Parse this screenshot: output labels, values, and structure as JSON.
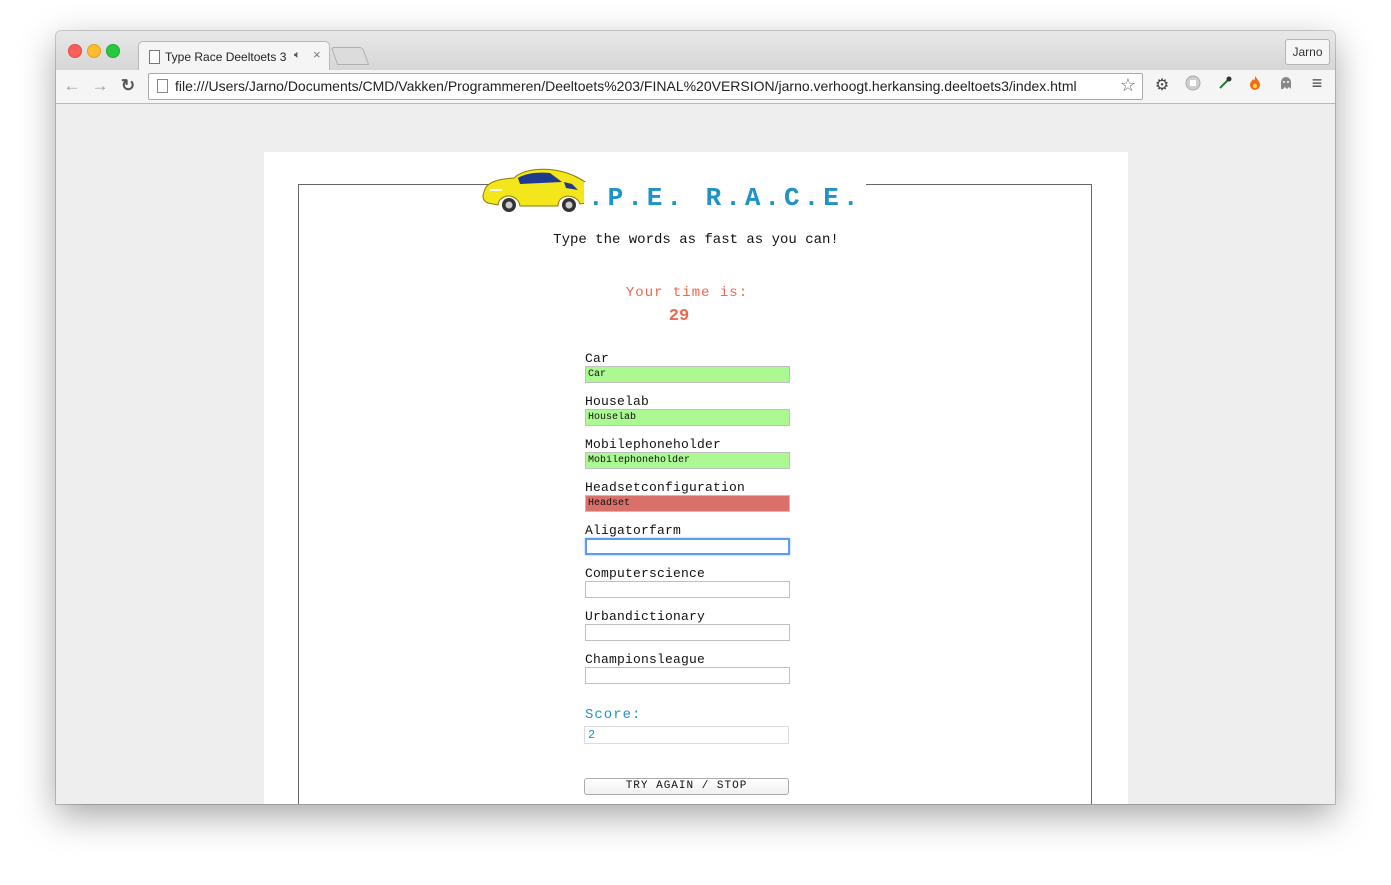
{
  "browser": {
    "tab_title": "Type Race Deeltoets 3",
    "profile_name": "Jarno",
    "url": "file:///Users/Jarno/Documents/CMD/Vakken/Programmeren/Deeltoets%203/FINAL%20VERSION/jarno.verhoogt.herkansing.deeltoets3/index.html",
    "icons": [
      "back-icon",
      "forward-icon",
      "reload-icon",
      "star-icon",
      "gear-icon",
      "adblock-icon",
      "eyedropper-icon",
      "fire-icon",
      "ghost-icon",
      "menu-icon"
    ]
  },
  "game": {
    "title": ".P.E. R.A.C.E.",
    "subtitle": "Type the words as fast as you can!",
    "time_label": "Your time is:",
    "time_value": "29",
    "words": [
      {
        "label": "Car",
        "value": "Car",
        "state": "correct"
      },
      {
        "label": "Houselab",
        "value": "Houselab",
        "state": "correct"
      },
      {
        "label": "Mobilephoneholder",
        "value": "Mobilephoneholder",
        "state": "correct"
      },
      {
        "label": "Headsetconfiguration",
        "value": "Headset",
        "state": "wrong"
      },
      {
        "label": "Aligatorfarm",
        "value": "",
        "state": "focused"
      },
      {
        "label": "Computerscience",
        "value": "",
        "state": "empty"
      },
      {
        "label": "Urbandictionary",
        "value": "",
        "state": "empty"
      },
      {
        "label": "Championsleague",
        "value": "",
        "state": "empty"
      }
    ],
    "score_label": "Score:",
    "score_value": "2",
    "reset_button": "TRY AGAIN / STOP"
  },
  "colors": {
    "title_blue": "#1f93c9",
    "time_red": "#f2664b",
    "correct_green": "#acf993",
    "wrong_red": "#d9716a"
  }
}
